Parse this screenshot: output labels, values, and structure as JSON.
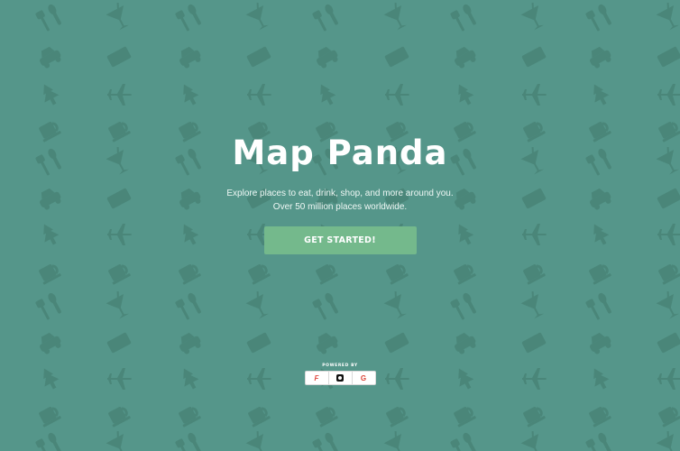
{
  "hero": {
    "title": "Map Panda",
    "subtitle_line1": "Explore places to eat, drink, shop, and more around you.",
    "subtitle_line2": "Over 50 million places worldwide.",
    "cta_label": "GET STARTED!"
  },
  "powered_by": {
    "label": "POWERED BY",
    "providers": [
      {
        "name": "foursquare-logo",
        "glyph": "F",
        "color": "#e0483f"
      },
      {
        "name": "yelp-logo",
        "glyph": "◘",
        "color": "#111111"
      },
      {
        "name": "google-logo",
        "glyph": "G",
        "color": "#db4437"
      }
    ]
  },
  "colors": {
    "background": "#55968a",
    "pattern": "#4a8679",
    "button": "#74b98c"
  },
  "pattern_icons": [
    "cocktail-icon",
    "utensils-icon",
    "car-icon",
    "ticket-icon",
    "tree-icon",
    "airplane-icon",
    "coffee-icon"
  ]
}
